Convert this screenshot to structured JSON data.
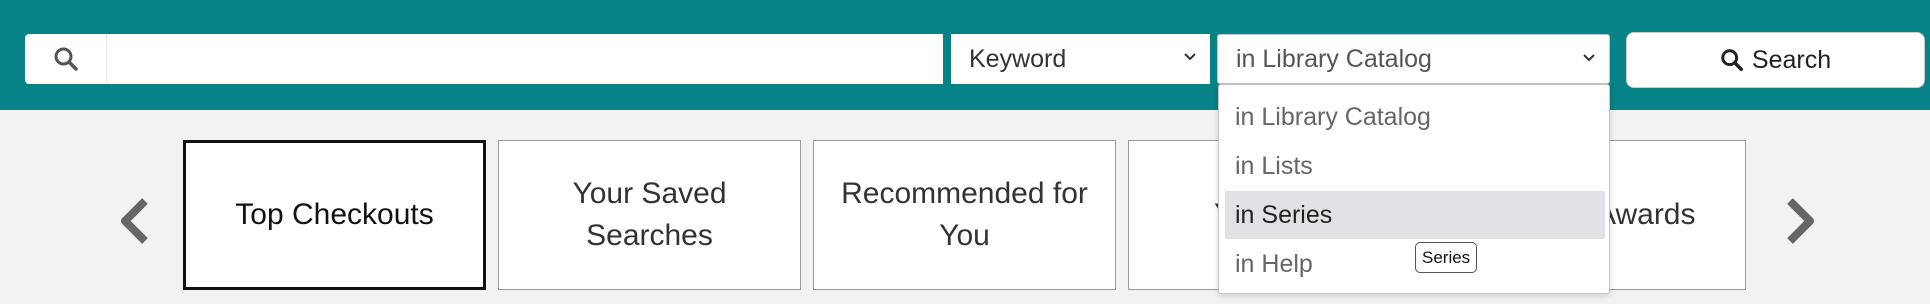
{
  "colors": {
    "header_bg": "#078287",
    "page_bg": "#f2f2f2",
    "dropdown_selected_bg": "#e1e1e6"
  },
  "search": {
    "value": "",
    "placeholder": "",
    "icon": "search-icon",
    "type_select": {
      "value": "Keyword",
      "icon": "chevron-down-icon"
    },
    "scope_select": {
      "value": "in Library Catalog",
      "icon": "chevron-down-icon",
      "options": [
        "in Library Catalog",
        "in Lists",
        "in Series",
        "in Help"
      ],
      "highlighted_option": "in Series",
      "tooltip": "Series"
    },
    "button_label": "Search"
  },
  "carousel": {
    "prev_icon": "chevron-left-icon",
    "next_icon": "chevron-right-icon",
    "cards": [
      {
        "label": "Top Checkouts",
        "active": true
      },
      {
        "label": "Your Saved Searches",
        "active": false
      },
      {
        "label": "Recommended for You",
        "active": false
      },
      {
        "label": "Y",
        "active": false
      },
      {
        "label": "Awards",
        "active": false
      }
    ]
  }
}
